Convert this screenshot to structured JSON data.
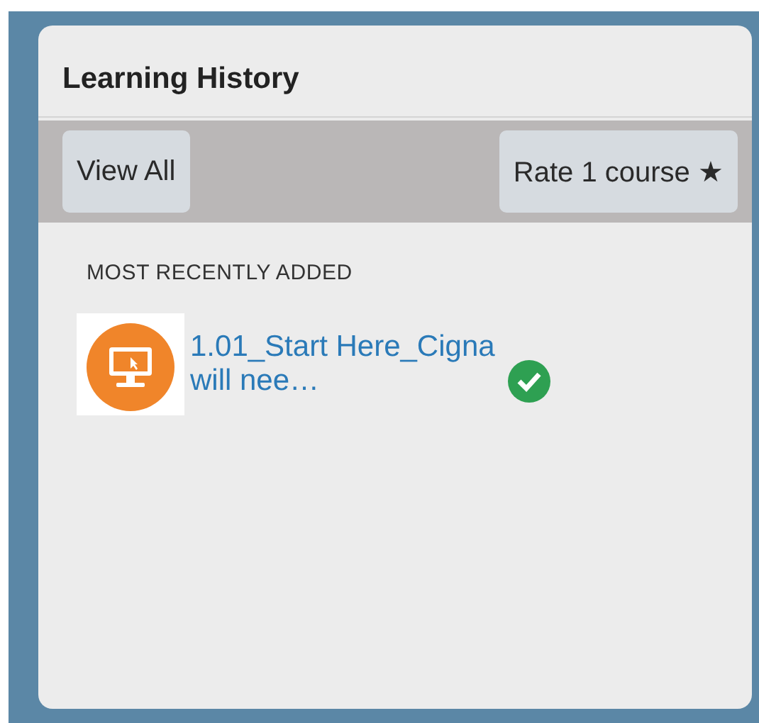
{
  "panel": {
    "title": "Learning History"
  },
  "toolbar": {
    "buttons": [
      "View All",
      "Rate 1 course ★"
    ]
  },
  "section": {
    "label": "MOST RECENTLY ADDED"
  },
  "courses": [
    {
      "title": "1.01_Start Here_Cigna will nee…",
      "completed": true
    }
  ]
}
